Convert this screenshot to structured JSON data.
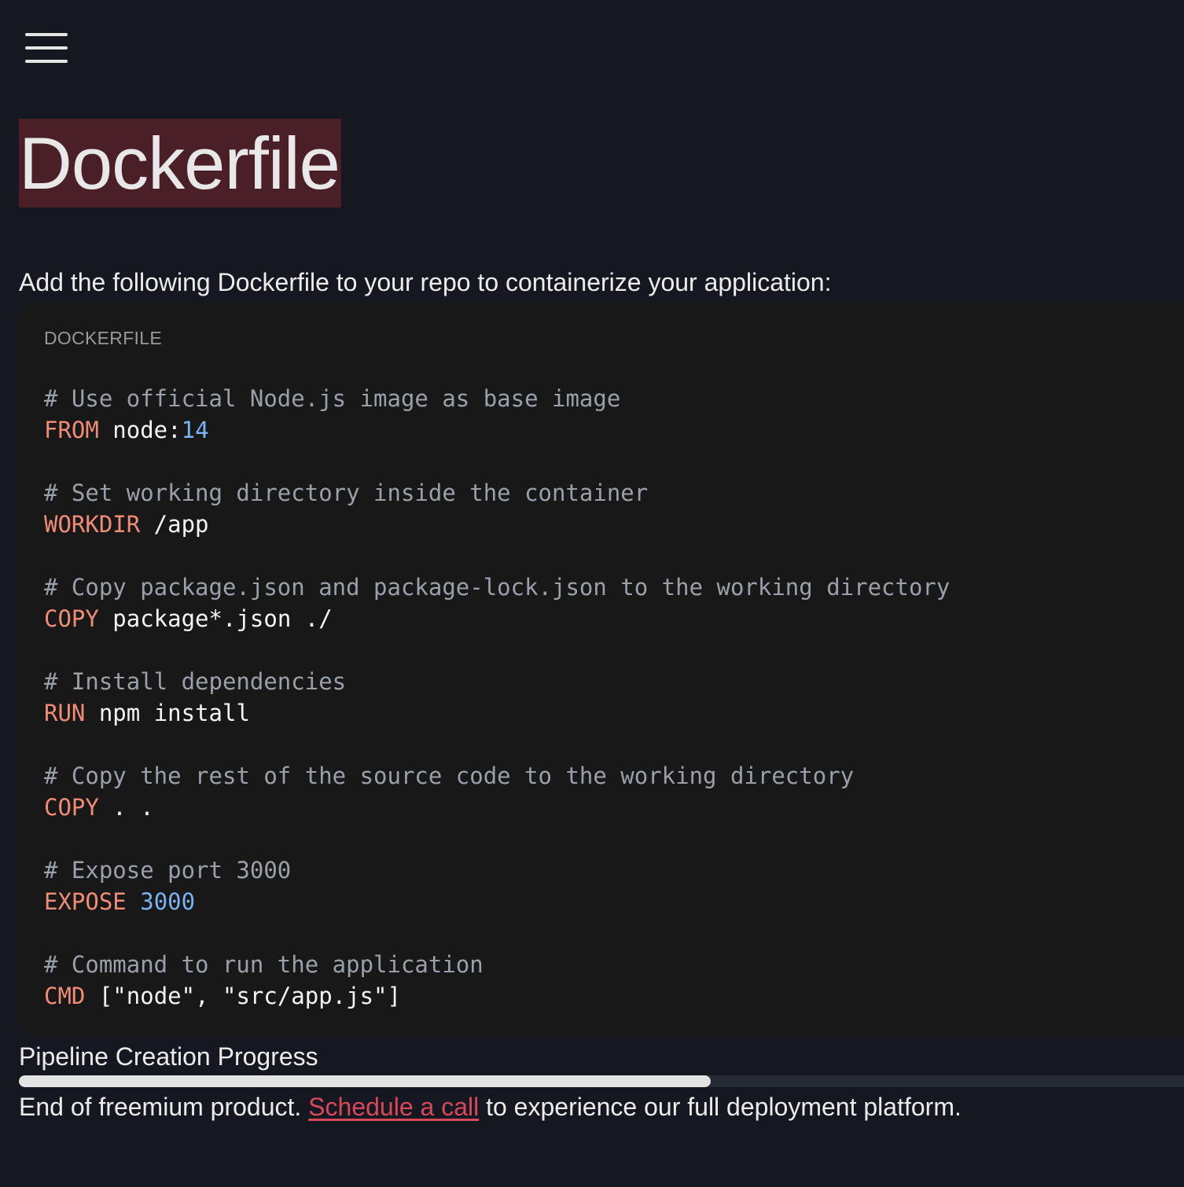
{
  "header": {
    "menu_icon": "hamburger-menu-icon"
  },
  "page": {
    "title": "Dockerfile",
    "intro": "Add the following Dockerfile to your repo to containerize your application:"
  },
  "code_block": {
    "language_label": "DOCKERFILE",
    "lines": [
      [
        {
          "t": "comment",
          "v": "# Use official Node.js image as base image"
        }
      ],
      [
        {
          "t": "kw",
          "v": "FROM"
        },
        {
          "t": "plain",
          "v": " node:"
        },
        {
          "t": "num",
          "v": "14"
        }
      ],
      [],
      [
        {
          "t": "comment",
          "v": "# Set working directory inside the container"
        }
      ],
      [
        {
          "t": "kw",
          "v": "WORKDIR"
        },
        {
          "t": "plain",
          "v": " /app"
        }
      ],
      [],
      [
        {
          "t": "comment",
          "v": "# Copy package.json and package-lock.json to the working directory"
        }
      ],
      [
        {
          "t": "kw",
          "v": "COPY"
        },
        {
          "t": "plain",
          "v": " package*.json ./"
        }
      ],
      [],
      [
        {
          "t": "comment",
          "v": "# Install dependencies"
        }
      ],
      [
        {
          "t": "kw",
          "v": "RUN"
        },
        {
          "t": "plain",
          "v": " npm install"
        }
      ],
      [],
      [
        {
          "t": "comment",
          "v": "# Copy the rest of the source code to the working directory"
        }
      ],
      [
        {
          "t": "kw",
          "v": "COPY"
        },
        {
          "t": "plain",
          "v": " . ."
        }
      ],
      [],
      [
        {
          "t": "comment",
          "v": "# Expose port 3000"
        }
      ],
      [
        {
          "t": "kw",
          "v": "EXPOSE"
        },
        {
          "t": "plain",
          "v": " "
        },
        {
          "t": "num",
          "v": "3000"
        }
      ],
      [],
      [
        {
          "t": "comment",
          "v": "# Command to run the application"
        }
      ],
      [
        {
          "t": "kw",
          "v": "CMD"
        },
        {
          "t": "plain",
          "v": " [\"node\", \"src/app.js\"]"
        }
      ]
    ]
  },
  "progress": {
    "label": "Pipeline Creation Progress",
    "value_fraction": 0.594
  },
  "footer": {
    "prefix": "End of freemium product. ",
    "link_text": "Schedule a call",
    "suffix": " to experience our full deployment platform."
  },
  "colors": {
    "background": "#151821",
    "title_highlight": "#4a1f28",
    "code_background": "#181818",
    "keyword": "#f08c76",
    "number": "#7ab3f2",
    "comment": "#9ba0a8",
    "link": "#d9485a"
  }
}
